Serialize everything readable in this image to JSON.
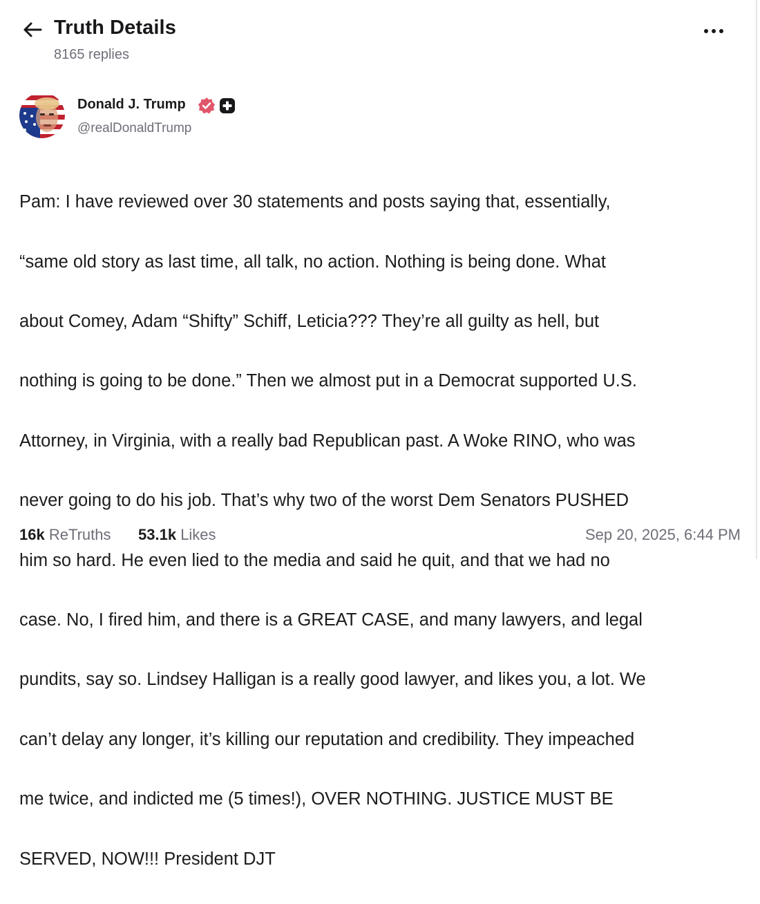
{
  "header": {
    "title": "Truth Details",
    "replies": "8165 replies"
  },
  "author": {
    "name": "Donald J. Trump",
    "handle": "@realDonaldTrump",
    "verified_icon": "verified-badge-icon",
    "plus_icon": "plus-badge-icon"
  },
  "post": {
    "lines": [
      "Pam: I have reviewed over 30 statements and posts saying that, essentially,",
      "“same old story as last time, all talk, no action. Nothing is being done. What",
      "about Comey, Adam “Shifty” Schiff, Leticia??? They’re all guilty as hell, but",
      "nothing is going to be done.” Then we almost put in a Democrat supported U.S.",
      "Attorney, in Virginia, with a really bad Republican past. A Woke RINO, who was",
      "never going to do his job. That’s why two of the worst Dem Senators PUSHED",
      "him so hard. He even lied to the media and said he quit, and that we had no",
      "case. No, I fired him, and there is a GREAT CASE, and many lawyers, and legal",
      "pundits, say so. Lindsey Halligan is a really good lawyer, and likes you, a lot. We",
      "can’t delay any longer, it’s killing our reputation and credibility. They impeached",
      "me twice, and indicted me (5 times!), OVER NOTHING. JUSTICE MUST BE",
      "SERVED, NOW!!! President DJT"
    ]
  },
  "footer": {
    "retruths_count": "16k",
    "retruths_label": "ReTruths",
    "likes_count": "53.1k",
    "likes_label": "Likes",
    "timestamp": "Sep 20, 2025, 6:44 PM"
  },
  "colors": {
    "text_primary": "#1c1c1f",
    "text_secondary": "#6e6e78",
    "verified_badge": "#e0566a"
  }
}
